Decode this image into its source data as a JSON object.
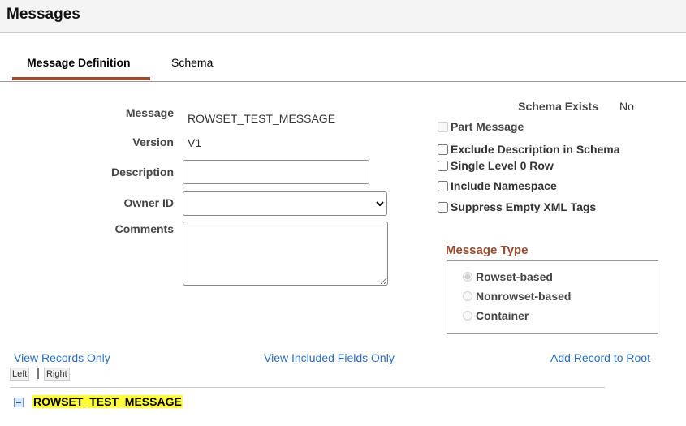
{
  "page": {
    "title": "Messages"
  },
  "tabs": [
    {
      "label": "Message Definition",
      "active": true
    },
    {
      "label": "Schema",
      "active": false
    }
  ],
  "form": {
    "message_label": "Message",
    "message_value": "ROWSET_TEST_MESSAGE",
    "version_label": "Version",
    "version_value": "V1",
    "description_label": "Description",
    "description_value": "",
    "owner_label": "Owner ID",
    "owner_value": "",
    "comments_label": "Comments",
    "comments_value": ""
  },
  "schema": {
    "exists_label": "Schema Exists",
    "exists_value": "No"
  },
  "options": [
    {
      "label": "Part Message",
      "checked": false,
      "disabled": true
    },
    {
      "label": "Exclude Description in Schema",
      "checked": false,
      "disabled": false
    },
    {
      "label": "Single Level 0 Row",
      "checked": false,
      "disabled": false
    },
    {
      "label": "Include Namespace",
      "checked": false,
      "disabled": false
    },
    {
      "label": "Suppress Empty XML Tags",
      "checked": false,
      "disabled": false
    }
  ],
  "message_type": {
    "title": "Message Type",
    "options": [
      {
        "label": "Rowset-based",
        "selected": true
      },
      {
        "label": "Nonrowset-based",
        "selected": false
      },
      {
        "label": "Container",
        "selected": false
      }
    ]
  },
  "links": {
    "view_records": "View Records Only",
    "view_fields": "View Included Fields Only",
    "add_record": "Add Record to Root",
    "left": "Left",
    "right": "Right"
  },
  "tree": {
    "root": "ROWSET_TEST_MESSAGE",
    "toggle_icon": "collapse-icon"
  }
}
